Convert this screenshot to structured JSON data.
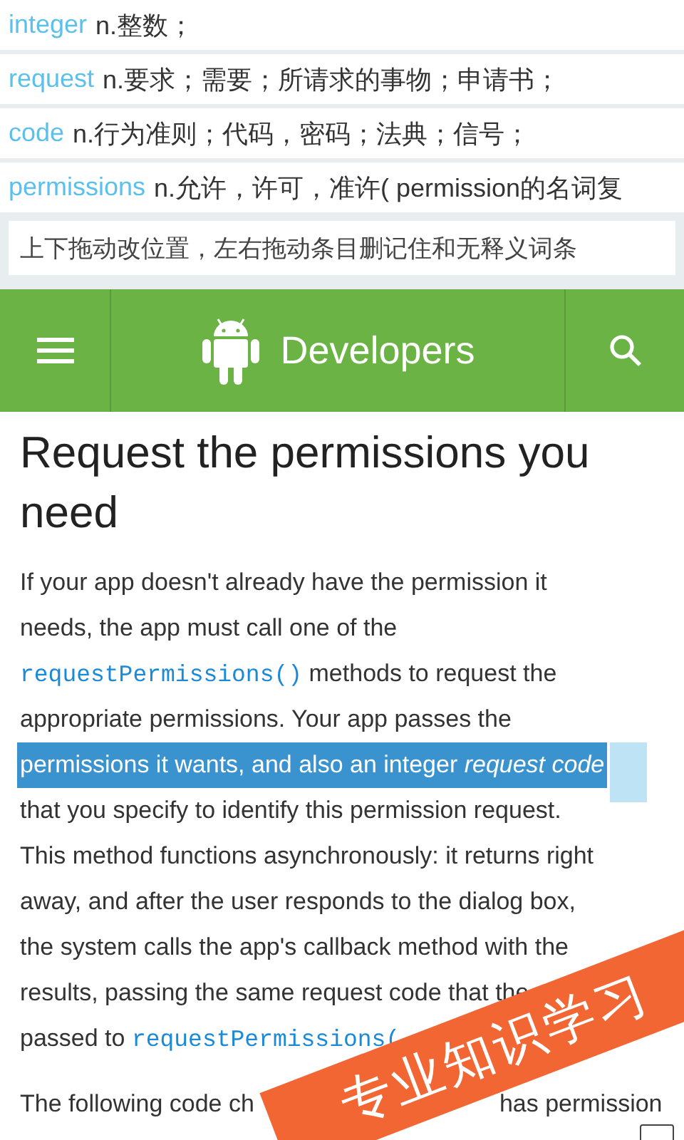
{
  "vocabulary": [
    {
      "word": "integer",
      "definition": "n.整数；"
    },
    {
      "word": "request",
      "definition": "n.要求；需要；所请求的事物；申请书；"
    },
    {
      "word": "code",
      "definition": "n.行为准则；代码，密码；法典；信号；"
    },
    {
      "word": "permissions",
      "definition": "n.允许，许可，准许( permission的名词复"
    }
  ],
  "hint": "上下拖动改位置，左右拖动条目删记住和无释义词条",
  "header": {
    "title": "Developers"
  },
  "heading": "Request the permissions you need",
  "lines": [
    {
      "selected": false,
      "segments": [
        {
          "kind": "text",
          "text": "If your app doesn't already have the permission it"
        }
      ]
    },
    {
      "selected": false,
      "segments": [
        {
          "kind": "text",
          "text": "needs, the app must call one of the"
        }
      ]
    },
    {
      "selected": false,
      "segments": [
        {
          "kind": "code",
          "text": "requestPermissions()"
        },
        {
          "kind": "text",
          "text": " methods to request the"
        }
      ]
    },
    {
      "selected": false,
      "segments": [
        {
          "kind": "text",
          "text": "appropriate permissions. Your app passes the"
        }
      ]
    },
    {
      "selected": true,
      "segments": [
        {
          "kind": "text",
          "text": "permissions it wants, and also an integer *request code*"
        }
      ]
    },
    {
      "selected": false,
      "segments": [
        {
          "kind": "text",
          "text": "that you specify to identify this permission request."
        }
      ]
    },
    {
      "selected": false,
      "segments": [
        {
          "kind": "text",
          "text": "This method functions asynchronously: it returns right"
        }
      ]
    },
    {
      "selected": false,
      "segments": [
        {
          "kind": "text",
          "text": "away, and after the user responds to the dialog box,"
        }
      ]
    },
    {
      "selected": false,
      "segments": [
        {
          "kind": "text",
          "text": "the system calls the app's callback method with the"
        }
      ]
    },
    {
      "selected": false,
      "segments": [
        {
          "kind": "text",
          "text": "results, passing the same request code that the"
        }
      ]
    },
    {
      "selected": false,
      "segments": [
        {
          "kind": "text",
          "text": "passed to "
        },
        {
          "kind": "code",
          "text": "requestPermissions("
        }
      ]
    }
  ],
  "last_line": [
    "The following code ch",
    "has permission"
  ],
  "banner": "专业知识学习"
}
